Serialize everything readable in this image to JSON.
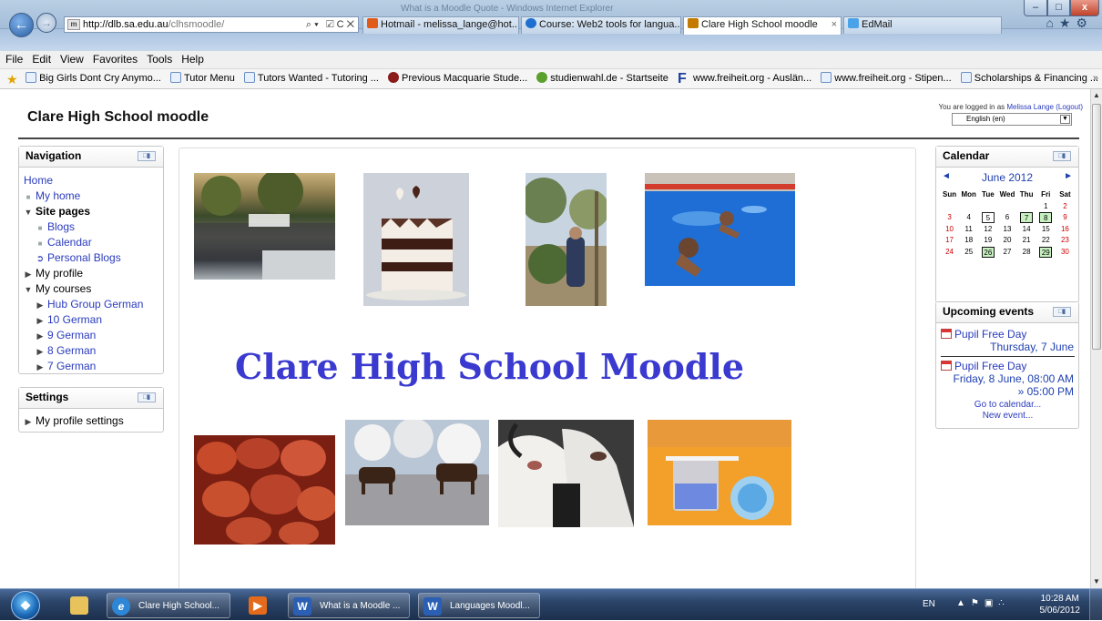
{
  "browser": {
    "window_title": "What is a Moodle Quote - Windows Internet Explorer",
    "address_host": "http://dlb.sa.edu.au",
    "address_path": "/clhsmoodle/",
    "address_tools": "⌕ ▾  ☑ C ✕",
    "tabs": [
      {
        "label": "Hotmail - melissa_lange@hot...",
        "icon_color": "#e05a1a",
        "active": false
      },
      {
        "label": "Course: Web2 tools for langua...",
        "icon_color": "#1f6fd1",
        "active": false
      },
      {
        "label": "Clare High School moodle",
        "icon_color": "#c27a00",
        "active": true,
        "close": "×"
      },
      {
        "label": "EdMail",
        "icon_color": "#4aa3e8",
        "active": false
      }
    ],
    "toolbar_icons": "⌂★⚙",
    "window_buttons": {
      "minimize": "–",
      "maximize": "□",
      "close": "x"
    },
    "back_icon": "←",
    "forward_icon": "→"
  },
  "menubar": {
    "items": [
      "File",
      "Edit",
      "View",
      "Favorites",
      "Tools",
      "Help"
    ]
  },
  "favorites": {
    "items": [
      "Big Girls Dont Cry Anymo...",
      "Tutor Menu",
      "Tutors Wanted - Tutoring ...",
      "Previous Macquarie Stude...",
      "studienwahl.de - Startseite",
      "www.freiheit.org - Auslän...",
      "www.freiheit.org - Stipen...",
      "Scholarships & Financing ..."
    ],
    "more": "»"
  },
  "site": {
    "title": "Clare High School moodle",
    "login_prefix": "You are logged in as",
    "user_name": "Melissa Lange",
    "logout": "(Logout)",
    "language": "English (en)",
    "language_caret": "▼"
  },
  "navigation": {
    "title": "Navigation",
    "home": "Home",
    "my_home": "My home",
    "site_pages": "Site pages",
    "blogs": "Blogs",
    "calendar": "Calendar",
    "personal_blogs": "Personal Blogs",
    "my_profile": "My profile",
    "my_courses": "My courses",
    "courses": [
      "Hub Group German",
      "10 German",
      "9 German",
      "8 German",
      "7 German"
    ]
  },
  "settings": {
    "title": "Settings",
    "my_profile_settings": "My profile settings"
  },
  "main": {
    "heading": "Clare High School Moodle"
  },
  "calendar": {
    "title": "Calendar",
    "prev": "◄",
    "next": "►",
    "month": "June 2012",
    "days": [
      "Sun",
      "Mon",
      "Tue",
      "Wed",
      "Thu",
      "Fri",
      "Sat"
    ],
    "weeks": [
      [
        "",
        "",
        "",
        "",
        "",
        "1",
        "2"
      ],
      [
        "3",
        "4",
        "5",
        "6",
        "7",
        "8",
        "9"
      ],
      [
        "10",
        "11",
        "12",
        "13",
        "14",
        "15",
        "16"
      ],
      [
        "17",
        "18",
        "19",
        "20",
        "21",
        "22",
        "23"
      ],
      [
        "24",
        "25",
        "26",
        "27",
        "28",
        "29",
        "30"
      ]
    ]
  },
  "upcoming": {
    "title": "Upcoming events",
    "events": [
      {
        "name": "Pupil Free Day",
        "date": "Thursday, 7 June"
      },
      {
        "name": "Pupil Free Day",
        "date": "Friday, 8 June, 08:00 AM",
        "end": "» 05:00 PM"
      }
    ],
    "go_to_calendar": "Go to calendar...",
    "new_event": "New event..."
  },
  "taskbar": {
    "items": [
      {
        "label": "Clare High School...",
        "icon": "e"
      },
      {
        "label": "What is a Moodle ...",
        "icon": "W"
      },
      {
        "label": "Languages Moodl...",
        "icon": "W"
      }
    ],
    "lang": "EN",
    "time": "10:28 AM",
    "date": "5/06/2012"
  }
}
